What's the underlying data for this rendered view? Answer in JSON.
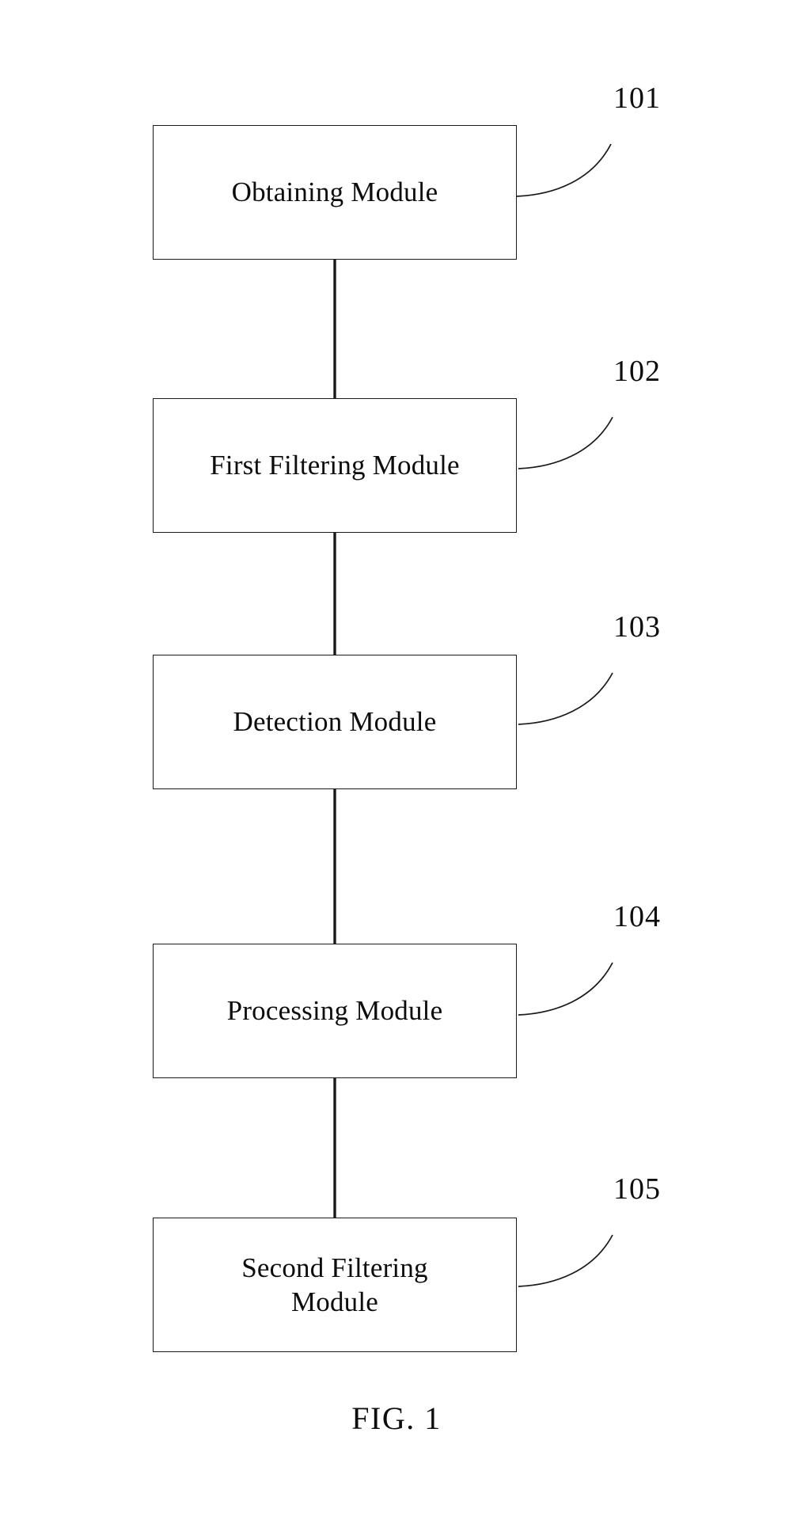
{
  "figure": {
    "caption": "FIG. 1",
    "type": "block-diagram"
  },
  "blocks": [
    {
      "id": "101",
      "label": "Obtaining Module",
      "ref": "101"
    },
    {
      "id": "102",
      "label": "First Filtering Module",
      "ref": "102"
    },
    {
      "id": "103",
      "label": "Detection Module",
      "ref": "103"
    },
    {
      "id": "104",
      "label": "Processing Module",
      "ref": "104"
    },
    {
      "id": "105",
      "label": "Second Filtering\nModule",
      "ref": "105"
    }
  ],
  "colors": {
    "ink": "#0d0d0d",
    "stroke": "#1a1a1a",
    "background": "#ffffff"
  }
}
